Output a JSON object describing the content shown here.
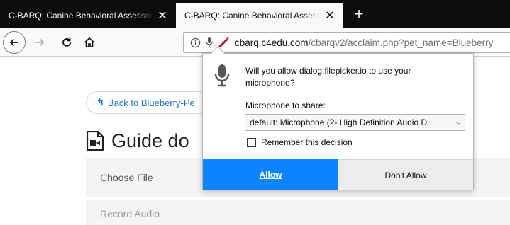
{
  "tabs": [
    {
      "title": "C-BARQ: Canine Behavioral Assessment",
      "active": false
    },
    {
      "title": "C-BARQ: Canine Behavioral Assessment",
      "active": true
    }
  ],
  "new_tab_label": "+",
  "url": {
    "domain": "cbarq.c4edu.com",
    "path": "/cbarqv2/acclaim.php?pet_name=Blueberry"
  },
  "page": {
    "back_link": "Back to Blueberry-Pe",
    "guide_title": "Guide do",
    "choose_file": "Choose File",
    "record_audio": "Record Audio"
  },
  "permission_popup": {
    "question": "Will you allow dialog.filepicker.io to use your microphone?",
    "share_label": "Microphone to share:",
    "selected_device": "default: Microphone (2- High Definition Audio D...",
    "remember_label": "Remember this decision",
    "remember_checked": false,
    "allow_label": "Allow",
    "deny_label": "Don't Allow"
  },
  "colors": {
    "tabstrip": "#0c0c0d",
    "allow_button": "#0a84ff",
    "link": "#1a6fc9"
  },
  "icons": {
    "back": "back-arrow-icon",
    "forward": "forward-arrow-icon",
    "reload": "reload-icon",
    "home": "home-icon",
    "info": "info-icon",
    "mic": "microphone-icon",
    "blocked": "blocked-permission-icon"
  }
}
